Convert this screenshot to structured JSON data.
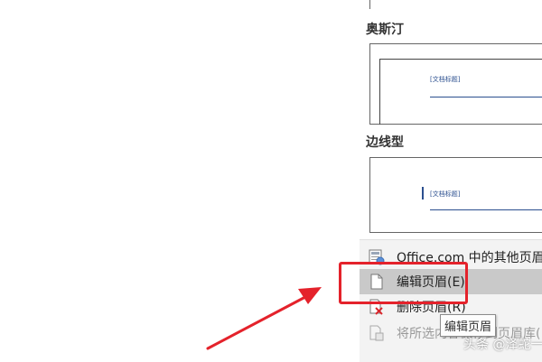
{
  "gallery": {
    "sections": [
      {
        "title": "奥斯汀",
        "placeholder": "[文档标题]"
      },
      {
        "title": "边线型",
        "placeholder": "[文档标题]"
      }
    ]
  },
  "menu": {
    "items": [
      {
        "label": "Office.com 中的其他页眉",
        "icon": "office-online-icon",
        "state": "normal"
      },
      {
        "label": "编辑页眉(E)",
        "icon": "page-icon",
        "state": "hover"
      },
      {
        "label": "删除页眉(R)",
        "icon": "delete-page-icon",
        "state": "normal"
      },
      {
        "label": "将所选内容保存到页眉库(",
        "icon": "save-page-icon",
        "state": "disabled"
      }
    ]
  },
  "tooltip": {
    "text": "编辑页眉"
  },
  "watermark": {
    "text": "头条 @泽蛇一"
  },
  "colors": {
    "highlight": "#e4222b",
    "arrow": "#e4222b",
    "placeholder_text": "#2b4f8f",
    "hover_bg": "#c9c9c9"
  }
}
